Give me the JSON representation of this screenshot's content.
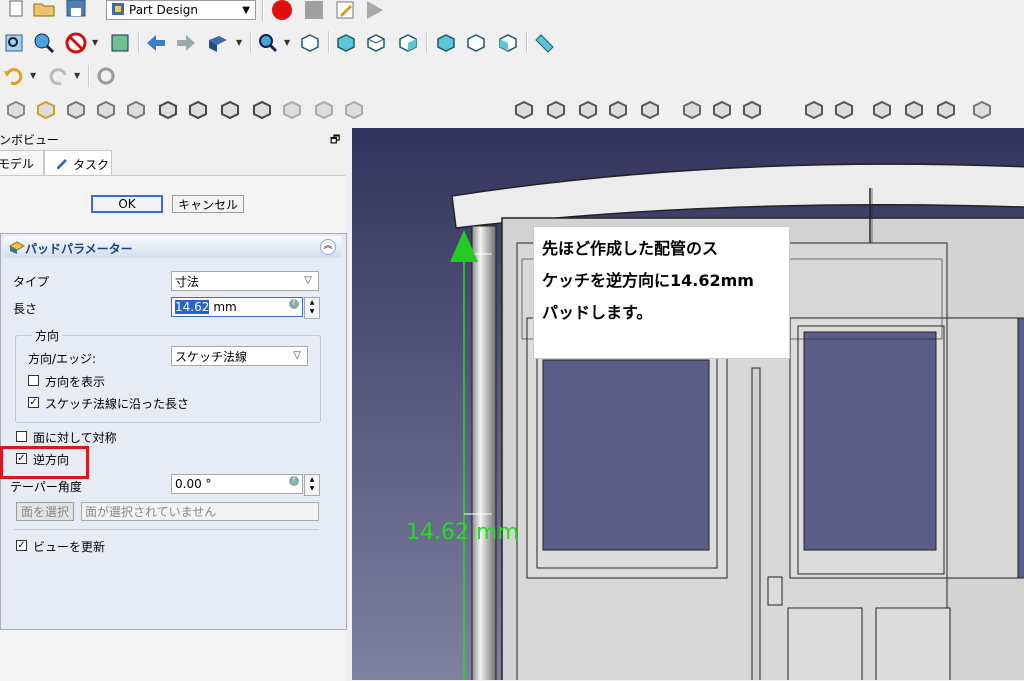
{
  "toolbar": {
    "workbench": "Part Design"
  },
  "combo_view": {
    "title": "コンボビュー",
    "tabs": [
      "モデル",
      "タスク"
    ],
    "ok_label": "OK",
    "cancel_label": "キャンセル"
  },
  "pad": {
    "panel_title": "パッドパラメーター",
    "type_label": "タイプ",
    "type_value": "寸法",
    "length_label": "長さ",
    "length_value": "14.62",
    "length_unit": "mm",
    "direction_group": "方向",
    "direction_edge_label": "方向/エッジ:",
    "direction_edge_value": "スケッチ法線",
    "show_direction_label": "方向を表示",
    "show_direction_checked": false,
    "along_normal_label": "スケッチ法線に沿った長さ",
    "along_normal_checked": true,
    "symmetric_label": "面に対して対称",
    "symmetric_checked": false,
    "reversed_label": "逆方向",
    "reversed_checked": true,
    "taper_label": "テーパー角度",
    "taper_value": "0.00 °",
    "select_face_button": "面を選択",
    "face_status": "面が選択されていません",
    "update_view_label": "ビューを更新",
    "update_view_checked": true
  },
  "viewport": {
    "dimension_label": "14.62 mm",
    "annotation_lines": [
      "先ほど作成した配管のス",
      "ケッチを逆方向に14.62mm",
      "パッドします。"
    ]
  },
  "colors": {
    "highlight": "#e0141e",
    "dimension": "#22dd22",
    "background_top": "#33335e",
    "background_bottom": "#8080a0"
  }
}
